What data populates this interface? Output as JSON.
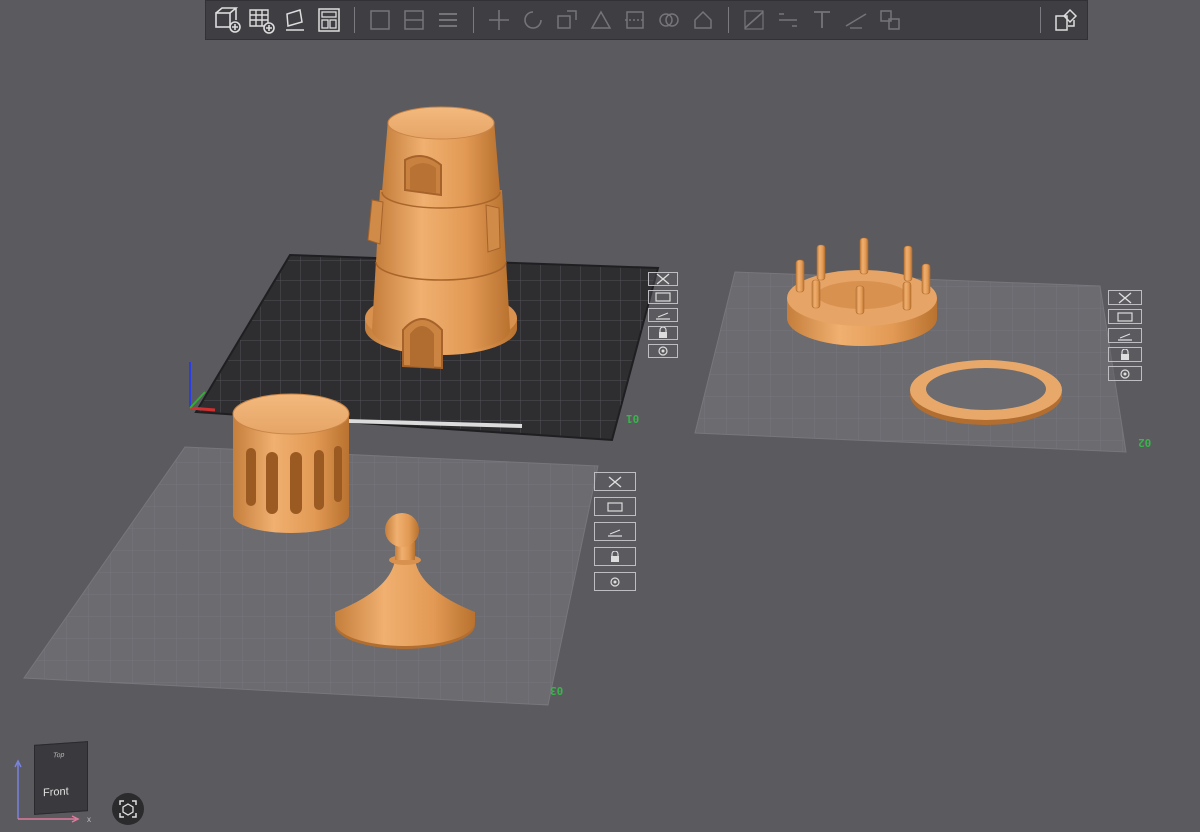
{
  "toolbar": {
    "buttons": [
      {
        "icon": "add-object-icon",
        "enabled": true
      },
      {
        "icon": "add-plate-icon",
        "enabled": true
      },
      {
        "icon": "auto-orient-icon",
        "enabled": true
      },
      {
        "icon": "arrange-icon",
        "enabled": true
      },
      {
        "icon": "split-objects-icon",
        "enabled": false
      },
      {
        "icon": "split-parts-icon",
        "enabled": false
      },
      {
        "icon": "layers-icon",
        "enabled": false
      },
      {
        "icon": "move-icon",
        "enabled": false
      },
      {
        "icon": "rotate-icon",
        "enabled": false
      },
      {
        "icon": "scale-icon",
        "enabled": false
      },
      {
        "icon": "lay-on-face-icon",
        "enabled": false
      },
      {
        "icon": "cut-icon",
        "enabled": false
      },
      {
        "icon": "mesh-boolean-icon",
        "enabled": false
      },
      {
        "icon": "support-paint-icon",
        "enabled": false
      },
      {
        "icon": "seam-paint-icon",
        "enabled": false
      },
      {
        "icon": "fuzzy-skin-icon",
        "enabled": false
      },
      {
        "icon": "text-icon",
        "enabled": false
      },
      {
        "icon": "measure-icon",
        "enabled": false
      },
      {
        "icon": "assembly-icon",
        "enabled": false
      },
      {
        "icon": "explode-icon",
        "enabled": true
      }
    ]
  },
  "plates": [
    {
      "number": "01",
      "type": "textured-pei",
      "active": true
    },
    {
      "number": "02",
      "type": "plain",
      "active": false
    },
    {
      "number": "03",
      "type": "plain",
      "active": false
    }
  ],
  "plate_tool_icons": [
    "close-icon",
    "arrange-plate-icon",
    "orient-plate-icon",
    "lock-icon",
    "settings-icon"
  ],
  "view_cube": {
    "top_label": "Top",
    "front_label": "Front",
    "x_label": "x",
    "y_label": "y"
  },
  "colors": {
    "filament": "#e09d5a",
    "background": "#5a5a5f",
    "grid_green": "#39b54a"
  }
}
